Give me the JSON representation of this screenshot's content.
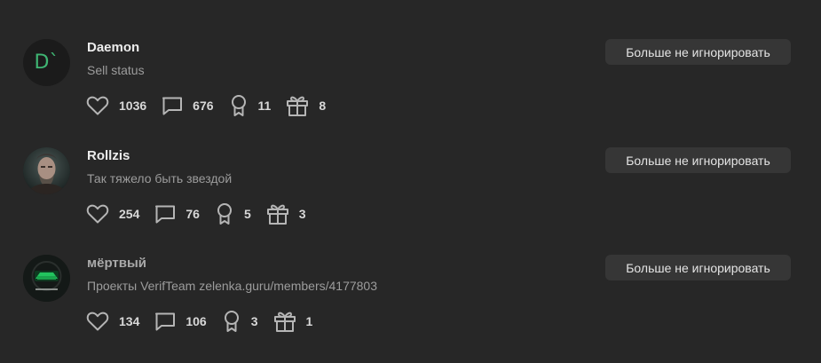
{
  "users": [
    {
      "name": "Daemon",
      "status": "Sell status",
      "avatar_text": "D`",
      "button_label": "Больше не игнорировать",
      "likes": "1036",
      "messages": "676",
      "trophies": "11",
      "gifts": "8"
    },
    {
      "name": "Rollzis",
      "status": "Так тяжело быть звездой",
      "button_label": "Больше не игнорировать",
      "likes": "254",
      "messages": "76",
      "trophies": "5",
      "gifts": "3"
    },
    {
      "name": "мёртвый",
      "status": "Проекты VerifTeam zelenka.guru/members/4177803",
      "button_label": "Больше не игнорировать",
      "likes": "134",
      "messages": "106",
      "trophies": "3",
      "gifts": "1"
    }
  ],
  "colors": {
    "background": "#272727",
    "button_bg": "#363636",
    "avatar_accent": "#3fb573"
  }
}
